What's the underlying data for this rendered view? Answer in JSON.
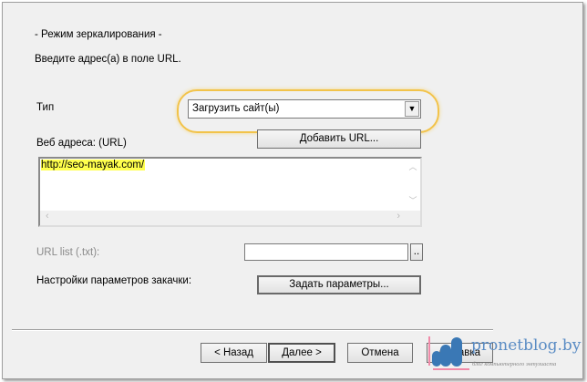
{
  "header": {
    "mode": "- Режим зеркалирования -",
    "instruction": "Введите адрес(а) в поле URL."
  },
  "type": {
    "label": "Тип",
    "selected": "Загрузить сайт(ы)"
  },
  "urls": {
    "label": "Веб адреса: (URL)",
    "add_button": "Добавить URL...",
    "value": "http://seo-mayak.com/"
  },
  "url_list": {
    "label": "URL list (.txt):",
    "value": "",
    "browse": ".."
  },
  "settings": {
    "label": "Настройки параметров закачки:",
    "button": "Задать параметры..."
  },
  "footer": {
    "back": "< Назад",
    "next": "Далее >",
    "cancel": "Отмена",
    "help": "Справка"
  },
  "watermark": {
    "site": "pronetblog.by",
    "tagline": "блог компьютерного энтузиаста"
  },
  "colors": {
    "highlight": "#ffff4d",
    "ellipse": "#f2c34a",
    "logo": "#3a78b5"
  }
}
